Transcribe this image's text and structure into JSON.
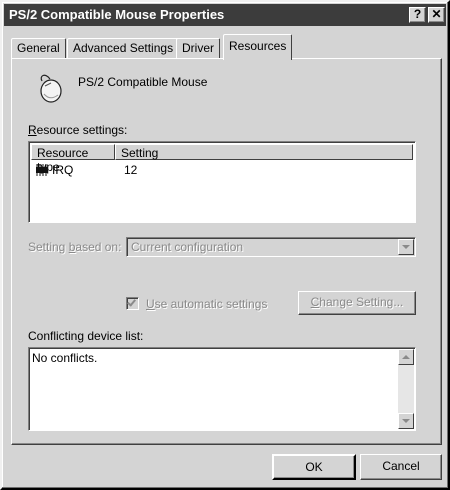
{
  "window": {
    "title": "PS/2 Compatible Mouse Properties",
    "help_button": "?",
    "close_button": "✕"
  },
  "tabs": [
    {
      "label": "General"
    },
    {
      "label": "Advanced Settings"
    },
    {
      "label": "Driver"
    },
    {
      "label": "Resources",
      "active": true
    }
  ],
  "device": {
    "name": "PS/2 Compatible Mouse",
    "icon": "mouse-icon"
  },
  "resource_settings": {
    "label_prefix": "R",
    "label_rest": "esource settings:",
    "columns": [
      "Resource type",
      "Setting"
    ],
    "rows": [
      {
        "icon": "chip-icon",
        "type": "IRQ",
        "setting": "12"
      }
    ]
  },
  "setting_based_on": {
    "label_start": "Setting ",
    "label_u": "b",
    "label_end": "ased on:",
    "value": "Current configuration",
    "enabled": false
  },
  "automatic": {
    "checked": true,
    "enabled": false,
    "label_u": "U",
    "label_rest": "se automatic settings"
  },
  "change_setting_button": {
    "label_u": "C",
    "label_rest": "hange Setting...",
    "enabled": false
  },
  "conflicts": {
    "label": "Conflicting device list:",
    "text": "No conflicts."
  },
  "buttons": {
    "ok": "OK",
    "cancel": "Cancel"
  },
  "colors": {
    "face": "#d4d4d4",
    "titlebar": "#3c3c3c",
    "disabled_text": "#8a8a8a"
  }
}
